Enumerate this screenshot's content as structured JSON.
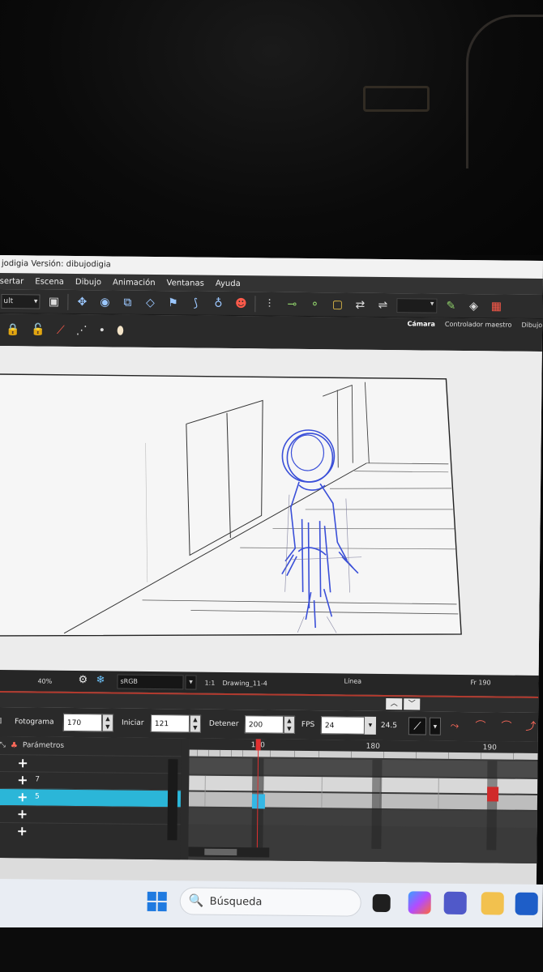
{
  "window": {
    "title": "jodigia Versión: dibujodigia"
  },
  "menu": [
    "sertar",
    "Escena",
    "Dibujo",
    "Animación",
    "Ventanas",
    "Ayuda"
  ],
  "toolbar": {
    "mode_value": "ult"
  },
  "panel_tabs": [
    {
      "label": "Cámara",
      "active": true
    },
    {
      "label": "Controlador maestro",
      "active": false
    },
    {
      "label": "Dibujo",
      "active": false
    }
  ],
  "status": {
    "zoom": "40%",
    "color_space": "sRGB",
    "ratio": "1:1",
    "drawing": "Drawing_11-4",
    "mode": "Línea",
    "frame": "Fr 190"
  },
  "timeline": {
    "fotograma_label": "Fotograma",
    "fotograma_value": "170",
    "iniciar_label": "Iniciar",
    "iniciar_value": "121",
    "detener_label": "Detener",
    "detener_value": "200",
    "fps_label": "FPS",
    "fps_value": "24",
    "fps_actual": "24.5",
    "ruler": [
      "170",
      "180",
      "190"
    ],
    "layers_header": "Parámetros",
    "layers": [
      {
        "num": "",
        "selected": false
      },
      {
        "num": "7",
        "selected": false
      },
      {
        "num": "5",
        "selected": true
      },
      {
        "num": "",
        "selected": false
      },
      {
        "num": "",
        "selected": false
      }
    ]
  },
  "taskbar": {
    "search_placeholder": "Búsqueda"
  },
  "colors": {
    "sketch_blue": "#3a4fd8",
    "selected_layer": "#2bb6d8",
    "playhead": "#e03030",
    "keyframe_red": "#d02a2a",
    "keyframe_cyan": "#34b8e6"
  }
}
